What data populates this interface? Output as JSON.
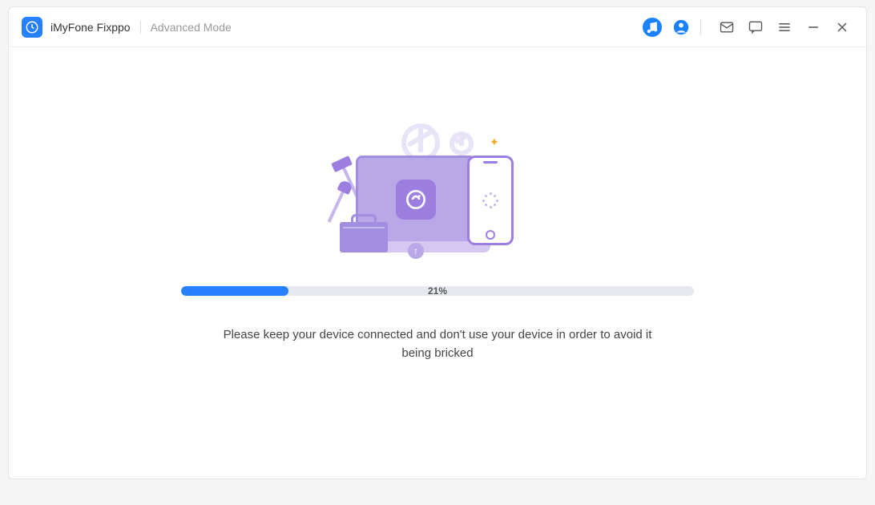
{
  "header": {
    "app_title": "iMyFone Fixppo",
    "mode": "Advanced Mode"
  },
  "icons": {
    "music": "music-notify-icon",
    "account": "account-icon",
    "mail": "mail-icon",
    "chat": "feedback-icon",
    "menu": "menu-icon",
    "minimize": "minimize-icon",
    "close": "close-icon"
  },
  "progress": {
    "percent": 21,
    "label": "21%"
  },
  "message": "Please keep your device connected and don't use your device in order to avoid it being bricked",
  "colors": {
    "accent": "#2680ff",
    "illustration_primary": "#9b7ee0",
    "illustration_light": "#c5b5ec"
  }
}
